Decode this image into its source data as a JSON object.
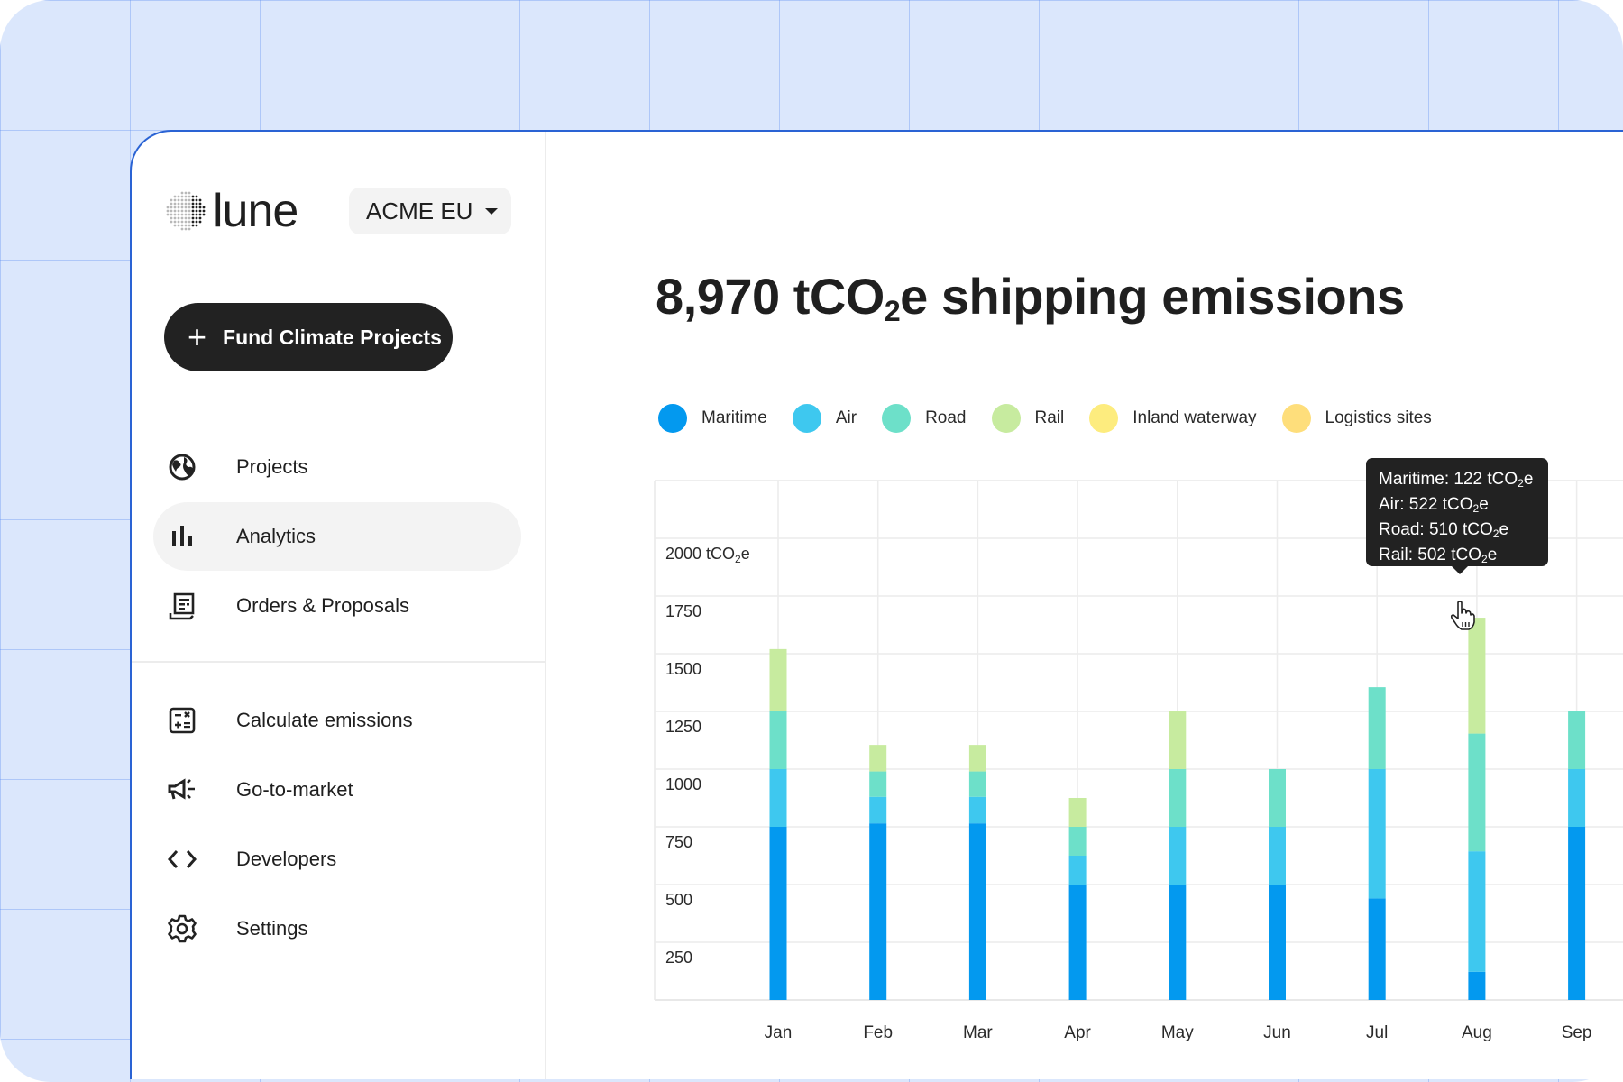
{
  "sidebar": {
    "logo_text": "lune",
    "org_selector": "ACME EU",
    "fund_button": "Fund Climate Projects",
    "nav_primary": [
      {
        "label": "Projects",
        "icon": "globe-icon",
        "active": false
      },
      {
        "label": "Analytics",
        "icon": "bar-chart-icon",
        "active": true
      },
      {
        "label": "Orders & Proposals",
        "icon": "receipt-icon",
        "active": false
      }
    ],
    "nav_secondary": [
      {
        "label": "Calculate emissions",
        "icon": "calculator-icon"
      },
      {
        "label": "Go-to-market",
        "icon": "megaphone-icon"
      },
      {
        "label": "Developers",
        "icon": "code-icon"
      },
      {
        "label": "Settings",
        "icon": "gear-icon"
      }
    ]
  },
  "header": {
    "title_value": "8,970 tCO",
    "title_sub": "2",
    "title_rest": "e shipping emissions"
  },
  "tooltip": {
    "month": "Aug",
    "lines": [
      {
        "label": "Maritime: 122 tCO",
        "sub": "2",
        "suffix": "e"
      },
      {
        "label": "Air: 522 tCO",
        "sub": "2",
        "suffix": "e"
      },
      {
        "label": "Road: 510 tCO",
        "sub": "2",
        "suffix": "e"
      },
      {
        "label": "Rail: 502 tCO",
        "sub": "2",
        "suffix": "e"
      }
    ]
  },
  "chart_data": {
    "type": "bar",
    "stacked": true,
    "title": "8,970 tCO2e shipping emissions",
    "xlabel": "",
    "ylabel": "tCO2e",
    "ylim": [
      0,
      2000
    ],
    "yticks": [
      250,
      500,
      750,
      1000,
      1250,
      1500,
      1750,
      2000
    ],
    "ytick_labels": [
      "250",
      "500",
      "750",
      "1000",
      "1250",
      "1500",
      "1750",
      "2000 tCO₂e"
    ],
    "grid": true,
    "legend_position": "top-left",
    "categories": [
      "Jan",
      "Feb",
      "Mar",
      "Apr",
      "May",
      "Jun",
      "Jul",
      "Aug",
      "Sep"
    ],
    "series": [
      {
        "name": "Maritime",
        "color": "#0399ef",
        "values": [
          750,
          765,
          765,
          500,
          500,
          500,
          440,
          122,
          750
        ]
      },
      {
        "name": "Air",
        "color": "#3ec8ef",
        "values": [
          250,
          115,
          115,
          125,
          250,
          250,
          560,
          522,
          250
        ]
      },
      {
        "name": "Road",
        "color": "#6de0c9",
        "values": [
          250,
          110,
          110,
          125,
          250,
          250,
          355,
          510,
          250
        ]
      },
      {
        "name": "Rail",
        "color": "#c7eb9f",
        "values": [
          270,
          115,
          115,
          125,
          250,
          0,
          0,
          502,
          0
        ]
      },
      {
        "name": "Inland waterway",
        "color": "#fdec7e",
        "values": [
          0,
          0,
          0,
          0,
          0,
          0,
          0,
          0,
          0
        ]
      },
      {
        "name": "Logistics sites",
        "color": "#fede7b",
        "values": [
          0,
          0,
          0,
          0,
          0,
          0,
          0,
          0,
          0
        ]
      }
    ]
  }
}
